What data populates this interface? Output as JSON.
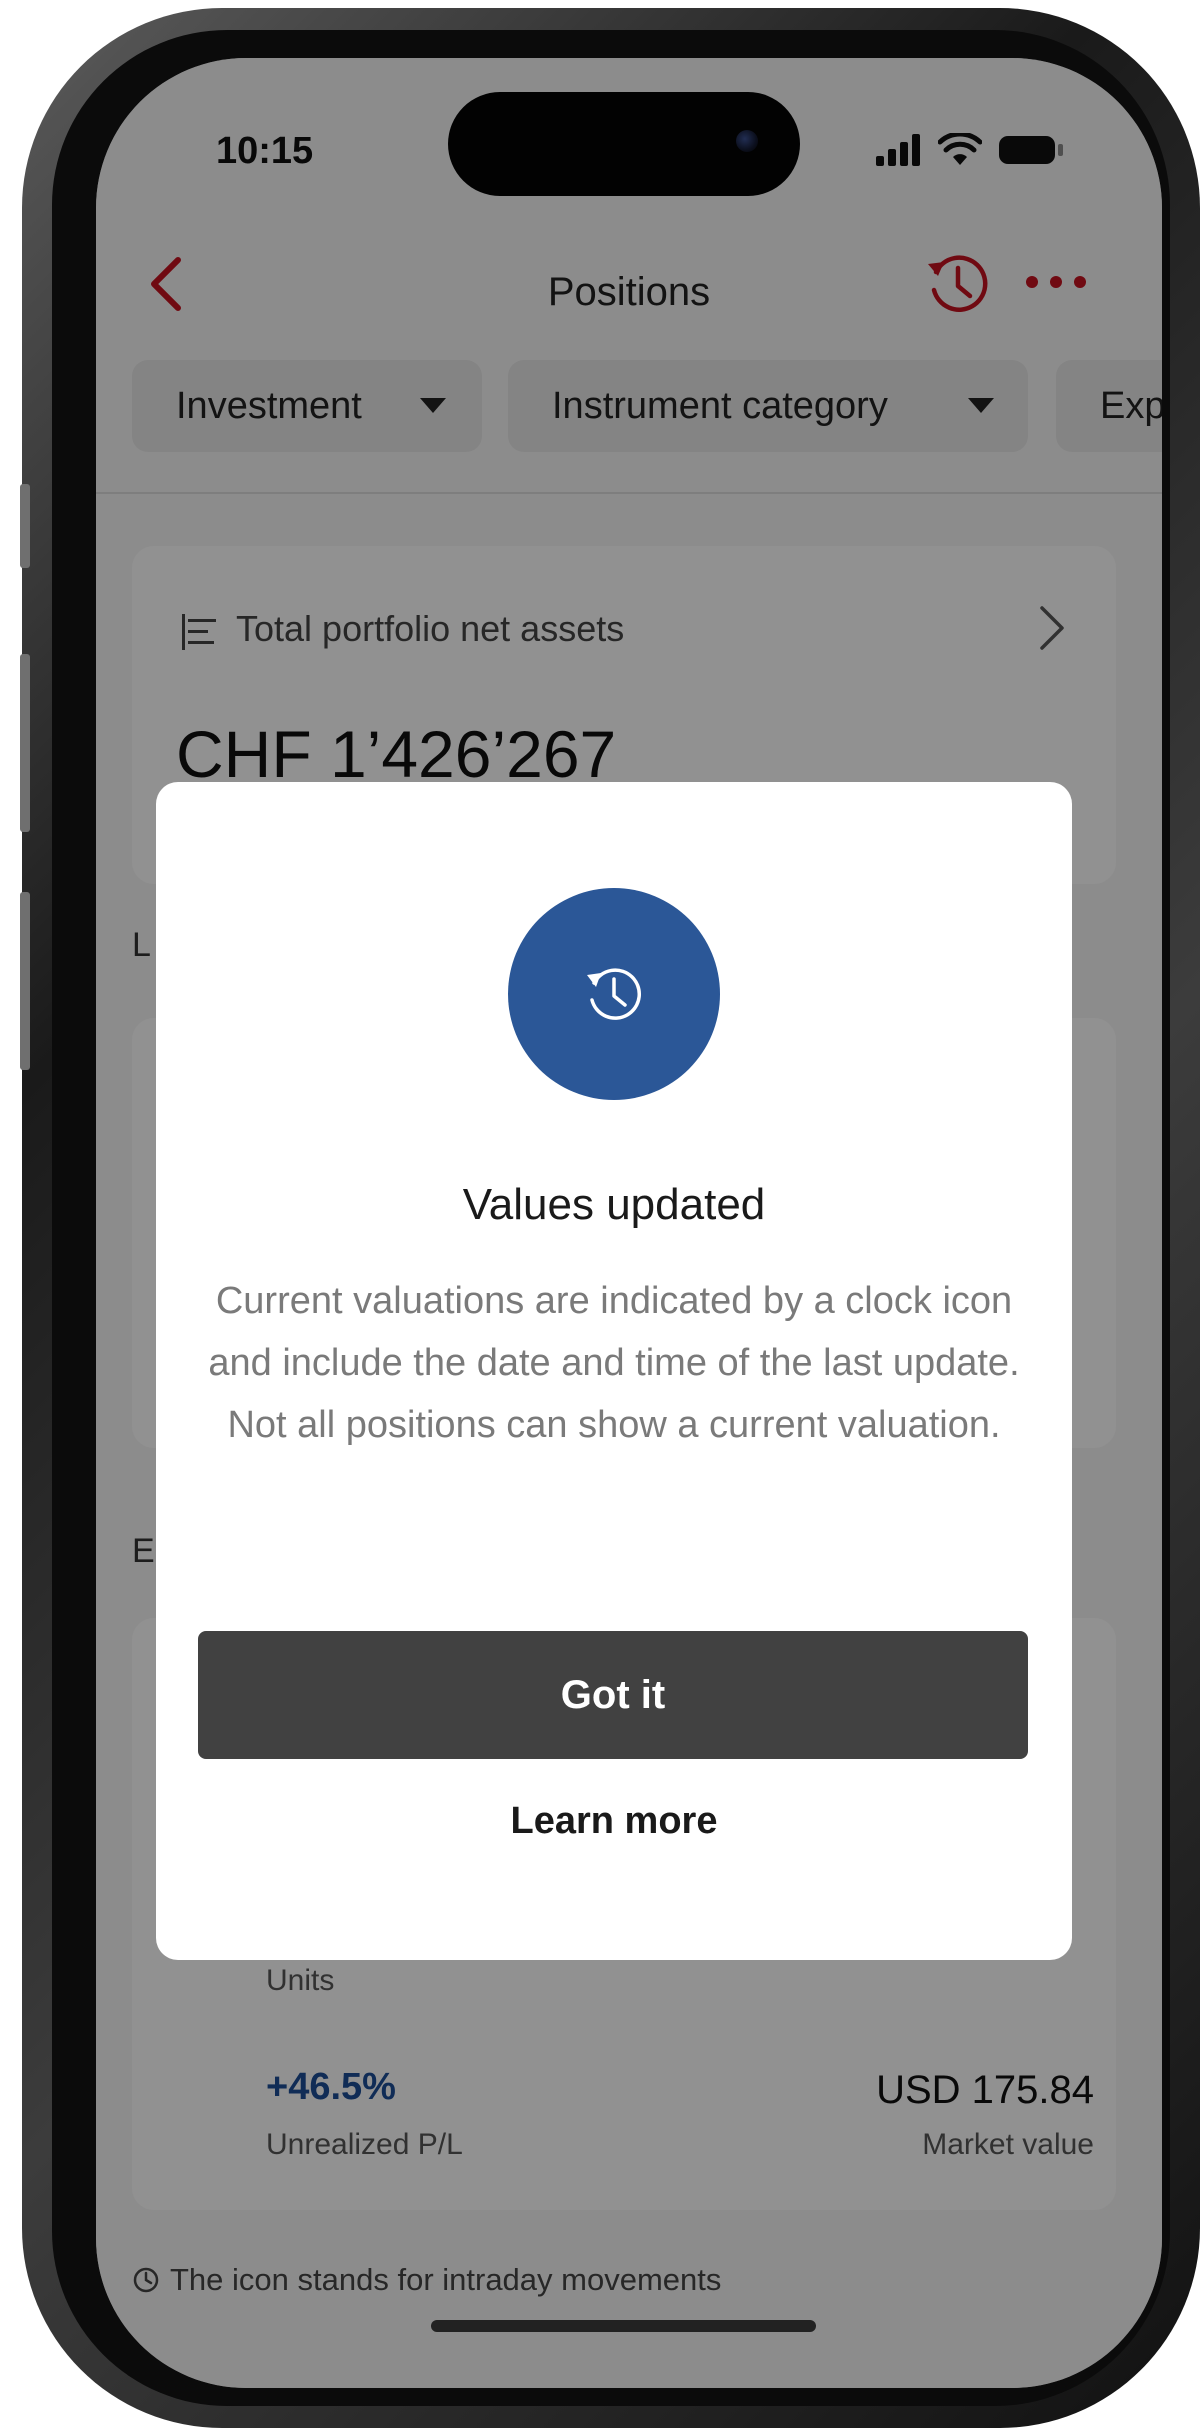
{
  "status_bar": {
    "time": "10:15",
    "icons": [
      "cellular-signal-icon",
      "wifi-icon",
      "battery-icon"
    ]
  },
  "nav": {
    "title": "Positions",
    "back_icon": "chevron-left-icon",
    "history_icon": "clock-history-icon",
    "more_icon": "ellipsis-icon",
    "accent_color": "#c1121f"
  },
  "filters": [
    {
      "label": "Investment"
    },
    {
      "label": "Instrument category"
    },
    {
      "label": "Exp"
    }
  ],
  "summary_card": {
    "label": "Total portfolio net assets",
    "amount": "CHF 1’426’267"
  },
  "background_sections": {
    "letter_1": "L",
    "letter_2": "E"
  },
  "position_card": {
    "units_label": "Units",
    "pl_value": "+46.5%",
    "pl_label": "Unrealized P/L",
    "pl_color": "#1d4d94",
    "market_value": "USD 175.84",
    "market_value_label": "Market value"
  },
  "footnote": {
    "text": "The icon stands for intraday movements",
    "icon": "clock-icon"
  },
  "dialog": {
    "icon": "clock-history-icon",
    "icon_bg_color": "#2b5797",
    "title": "Values updated",
    "body": "Current valuations are indicated by a clock icon and include the date and time of the last update. Not all positions can show a current valuation.",
    "primary_button": "Got it",
    "secondary_link": "Learn more"
  }
}
